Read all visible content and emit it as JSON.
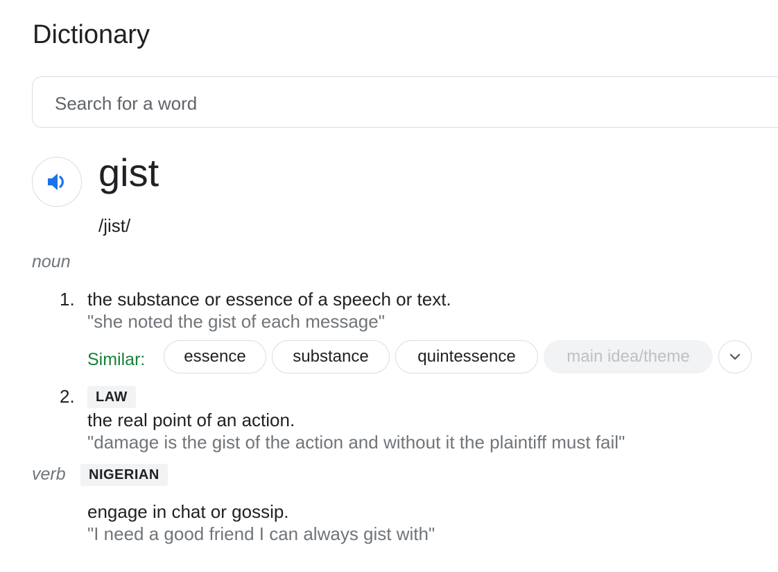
{
  "header": {
    "title": "Dictionary"
  },
  "search": {
    "placeholder": "Search for a word",
    "value": ""
  },
  "entry": {
    "word": "gist",
    "phonetic": "/jist/",
    "audio_icon": "speaker-icon",
    "noun": {
      "pos": "noun",
      "senses": [
        {
          "number": "1.",
          "definition": "the substance or essence of a speech or text.",
          "example": "\"she noted the gist of each message\"",
          "similar_label": "Similar:",
          "similar": [
            "essence",
            "substance",
            "quintessence",
            "main idea/theme"
          ],
          "expand_icon": "chevron-down-icon"
        },
        {
          "number": "2.",
          "tag": "LAW",
          "definition": "the real point of an action.",
          "example": "\"damage is the gist of the action and without it the plaintiff must fail\""
        }
      ]
    },
    "verb": {
      "pos": "verb",
      "tag": "NIGERIAN",
      "definition": "engage in chat or gossip.",
      "example": "\"I need a good friend I can always gist with\""
    }
  },
  "colors": {
    "accent_blue": "#1a73e8",
    "similar_green": "#188038",
    "muted_text": "#70757a",
    "border": "#dadce0"
  }
}
